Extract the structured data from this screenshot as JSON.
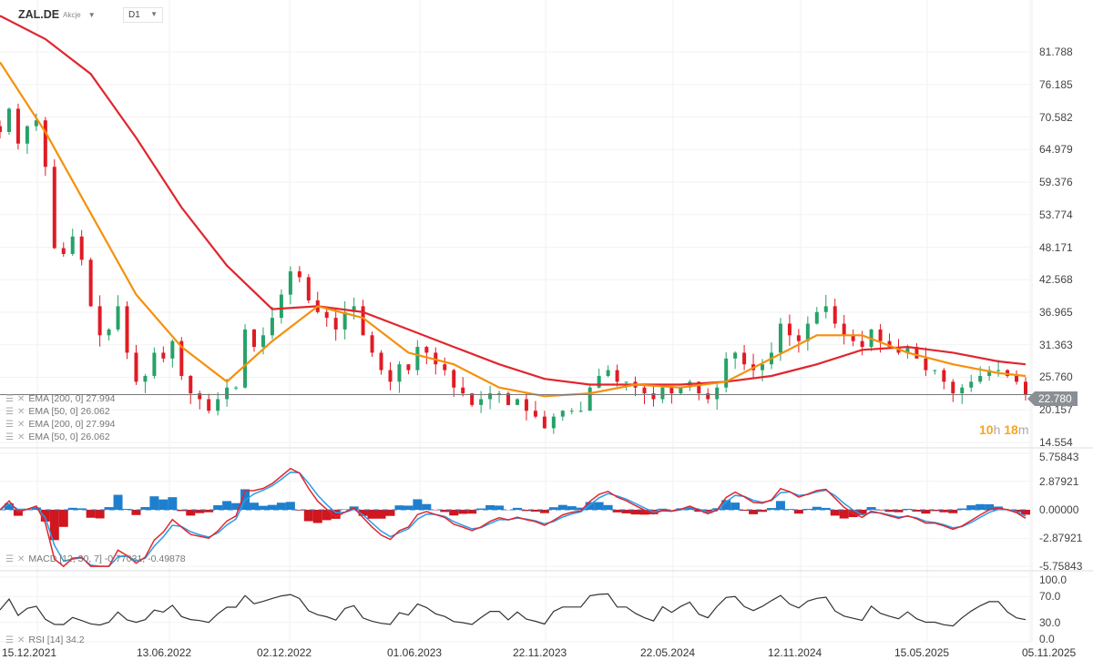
{
  "header": {
    "symbol": "ZAL.DE",
    "type": "Akcje",
    "timeframe": "D1"
  },
  "legend": {
    "main": [
      "EMA [200, 0] 27.994",
      "EMA [50, 0] 26.062",
      "EMA [200, 0] 27.994",
      "EMA [50, 0] 26.062"
    ],
    "macd": "MACD [12, 30, 7] -0.77031, -0.49878",
    "rsi": "RSI [14] 34.2"
  },
  "current_price": "22.780",
  "countdown": {
    "h": "10",
    "hu": "h",
    "m": "18",
    "mu": "m"
  },
  "colors": {
    "up": "#26a269",
    "down": "#e01b24",
    "ema50": "#f5900a",
    "ema200": "#e0262e",
    "macd_line": "#e0262e",
    "signal_line": "#2b9be8",
    "hist_pos": "#1f7fcf",
    "hist_neg": "#d0161e",
    "rsi": "#333333"
  },
  "chart_data": {
    "type": "line",
    "title": "ZAL.DE D1",
    "price_axis": {
      "ticks": [
        "81.788",
        "76.185",
        "70.582",
        "64.979",
        "59.376",
        "53.774",
        "48.171",
        "42.568",
        "36.965",
        "31.363",
        "25.760",
        "20.157",
        "14.554"
      ],
      "ylim": [
        14.554,
        81.788
      ]
    },
    "macd_axis": {
      "ticks": [
        "5.75843",
        "2.87921",
        "0.00000",
        "-2.87921",
        "-5.75843"
      ],
      "ylim": [
        -5.75843,
        5.75843
      ]
    },
    "rsi_axis": {
      "ticks": [
        "100.0",
        "70.0",
        "30.0",
        "0.0"
      ],
      "ylim": [
        0,
        100
      ]
    },
    "x_ticks": [
      "15.12.2021",
      "13.06.2022",
      "02.12.2022",
      "01.06.2023",
      "22.11.2023",
      "22.05.2024",
      "12.11.2024",
      "15.05.2025",
      "05.11.2025"
    ],
    "close": [
      68,
      72,
      66,
      69,
      70,
      62,
      48,
      47,
      50,
      46,
      38,
      33,
      34,
      38,
      30,
      25,
      26,
      30,
      29,
      32,
      26,
      23,
      22,
      20,
      22,
      24,
      24,
      34,
      31,
      33,
      36,
      40,
      44,
      43,
      39,
      37,
      36,
      34,
      37,
      38,
      33,
      30,
      27,
      25,
      28,
      27,
      31,
      30,
      28,
      27,
      24,
      23,
      21,
      22,
      23,
      23,
      21,
      22,
      20,
      19,
      17,
      19,
      20,
      20,
      20,
      24,
      26,
      27,
      25,
      25,
      24,
      23,
      22,
      24,
      23,
      24,
      25,
      23,
      22,
      24,
      29,
      30,
      28,
      27,
      28,
      30,
      35,
      33,
      32,
      35,
      37,
      38,
      35,
      33,
      32,
      31,
      34,
      32,
      31,
      30,
      31,
      29,
      27,
      27,
      25,
      23,
      24,
      25,
      26,
      27,
      27,
      26,
      25,
      22.78
    ],
    "ema50_every5": [
      80,
      68,
      54,
      40,
      31,
      25,
      32,
      38,
      36,
      30,
      28,
      24,
      22.5,
      23,
      24.5,
      24,
      25,
      29,
      33,
      33,
      30,
      28,
      26.5,
      26
    ],
    "ema200_every5": [
      88,
      84,
      78,
      67,
      55,
      45,
      37.5,
      38,
      37,
      34,
      31,
      28,
      25.5,
      24.5,
      24.5,
      24.5,
      25,
      26,
      28,
      30.5,
      31,
      30,
      28.5,
      28
    ]
  }
}
